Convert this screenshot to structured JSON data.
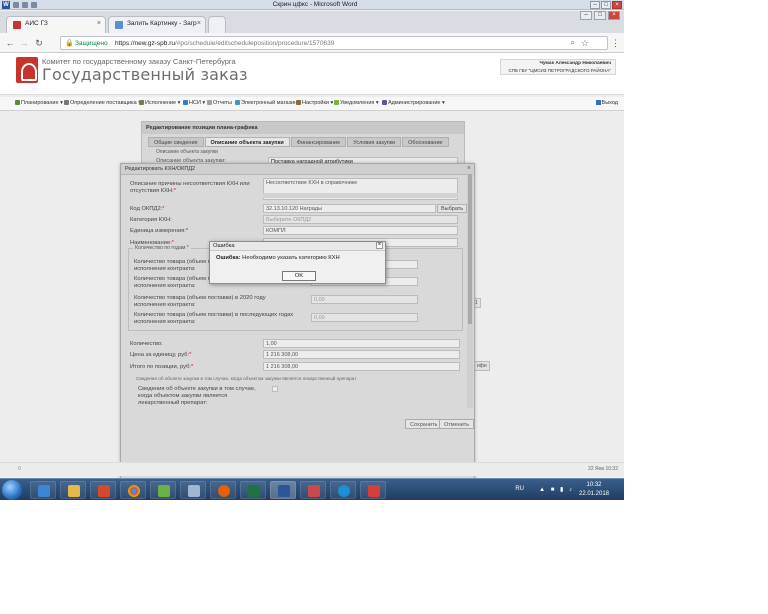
{
  "word": {
    "title": "Скрин цфкс - Microsoft Word",
    "icon_letter": "W"
  },
  "browser": {
    "tabs": [
      {
        "label": "АИС ГЗ",
        "active": true
      },
      {
        "label": "Залить Картинку - Загр",
        "active": false
      }
    ],
    "secure_label": "Защищено",
    "url_host": "https://new.gz-spb.ru",
    "url_path": "/#po/schedule/editscheduleposition/procedure/1570639"
  },
  "header": {
    "org_line": "Комитет по государственному заказу Санкт-Петербурга",
    "system_name": "Государственный заказ",
    "user_name": "Чумак Александр Николаевич",
    "user_org": "СПБ ГБУ \"ЦМСИЗ ПЕТРОГРАДСКОГО РАЙОНА\""
  },
  "menu": {
    "items": [
      "Планирование",
      "Определение поставщика",
      "Исполнение",
      "НСИ",
      "Отчеты",
      "Электронный магазин",
      "Настройки",
      "Уведомления",
      "Администрирование"
    ],
    "exit": "Выход"
  },
  "editor": {
    "title": "Редактирование позиции плана-графика",
    "tabs": [
      "Общие сведения",
      "Описание объекта закупки",
      "Финансирование",
      "Условия закупки",
      "Обоснование"
    ],
    "section": "Описание объекта закупки",
    "field_label": "Описание объекта закупки:",
    "field_value": "Поставка наградной атрибутики",
    "right_stubs": [
      "Уда",
      "ия 1",
      "ифи"
    ]
  },
  "dialog": {
    "title": "Редактировать КХН/ОКПД2",
    "reason_label": "Описание причины несоответствия КХН или отсутствия КХН:",
    "reason_value": "Несоответствие КХН в справочнике",
    "okpd_label": "Код ОКПД2:",
    "okpd_value": "32.13.10.120 Награды",
    "choose_button": "Выбрать",
    "category_label": "Категория КХН:",
    "category_placeholder": "Выберите ОКПД2",
    "unit_label": "Единица измерения:",
    "unit_value": "КОМПЛ",
    "name_label": "Наименование:",
    "qty_legend": "Количество по годам",
    "qty_rows": [
      "Количество товара (объем поставки) в текущем году исполнения контракта:",
      "Количество товара (объем поставки) в первом году исполнения контракта:",
      "Количество товара (объем поставки) в 2020 году исполнения контракта:",
      "Количество товара (объем поставки) в последующих годах исполнения контракта:"
    ],
    "qty_values": [
      "",
      "",
      "0,00",
      "0,00"
    ],
    "quantity_label": "Количество:",
    "quantity_value": "1,00",
    "price_label": "Цена за единицу, руб:",
    "price_value": "1 216 308,00",
    "total_label": "Итого по позиции, руб:",
    "total_value": "1 216 308,00",
    "drug_legend": "Сведения об объекте закупки в том случае, когда объектом закупки является лекарственный препарат",
    "drug_label": "Сведения об объекте закупки в том случае, когда объектом закупки является лекарственный препарат:",
    "save_button": "Сохранить",
    "cancel_button": "Отменить"
  },
  "error_modal": {
    "title": "Ошибка",
    "message_bold": "Ошибка:",
    "message": " Необходимо указать категорию КХН",
    "ok_button": "OK"
  },
  "status": {
    "left": "0",
    "right": "22 Янв 10:32"
  },
  "taskbar": {
    "lang": "RU",
    "time": "10:32",
    "date": "22.01.2018"
  }
}
